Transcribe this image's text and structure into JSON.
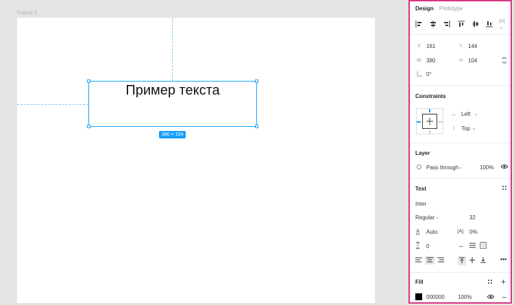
{
  "canvas": {
    "frame_label": "Frame 1",
    "sample_text": "Пример текста",
    "size_badge": "380 × 104"
  },
  "panel": {
    "tabs": [
      {
        "label": "Design",
        "active": true
      },
      {
        "label": "Prototype",
        "active": false
      }
    ],
    "transform": {
      "x_label": "X",
      "x_value": "161",
      "y_label": "Y",
      "y_value": "144",
      "w_label": "W",
      "w_value": "380",
      "h_label": "H",
      "h_value": "104",
      "rotation_value": "0°"
    },
    "constraints": {
      "title": "Constraints",
      "horizontal": "Left",
      "vertical": "Top"
    },
    "layer": {
      "title": "Layer",
      "blend_mode": "Pass through",
      "opacity": "100%"
    },
    "text": {
      "title": "Text",
      "font_family": "Inter",
      "font_style": "Regular",
      "font_size": "32",
      "line_height": "Auto",
      "letter_spacing": "0%",
      "paragraph_spacing": "0"
    },
    "fill": {
      "title": "Fill",
      "hex": "000000",
      "opacity": "100%",
      "color": "#000000"
    }
  },
  "colors": {
    "selection": "#18a0fb",
    "panel_border": "#d63384"
  }
}
